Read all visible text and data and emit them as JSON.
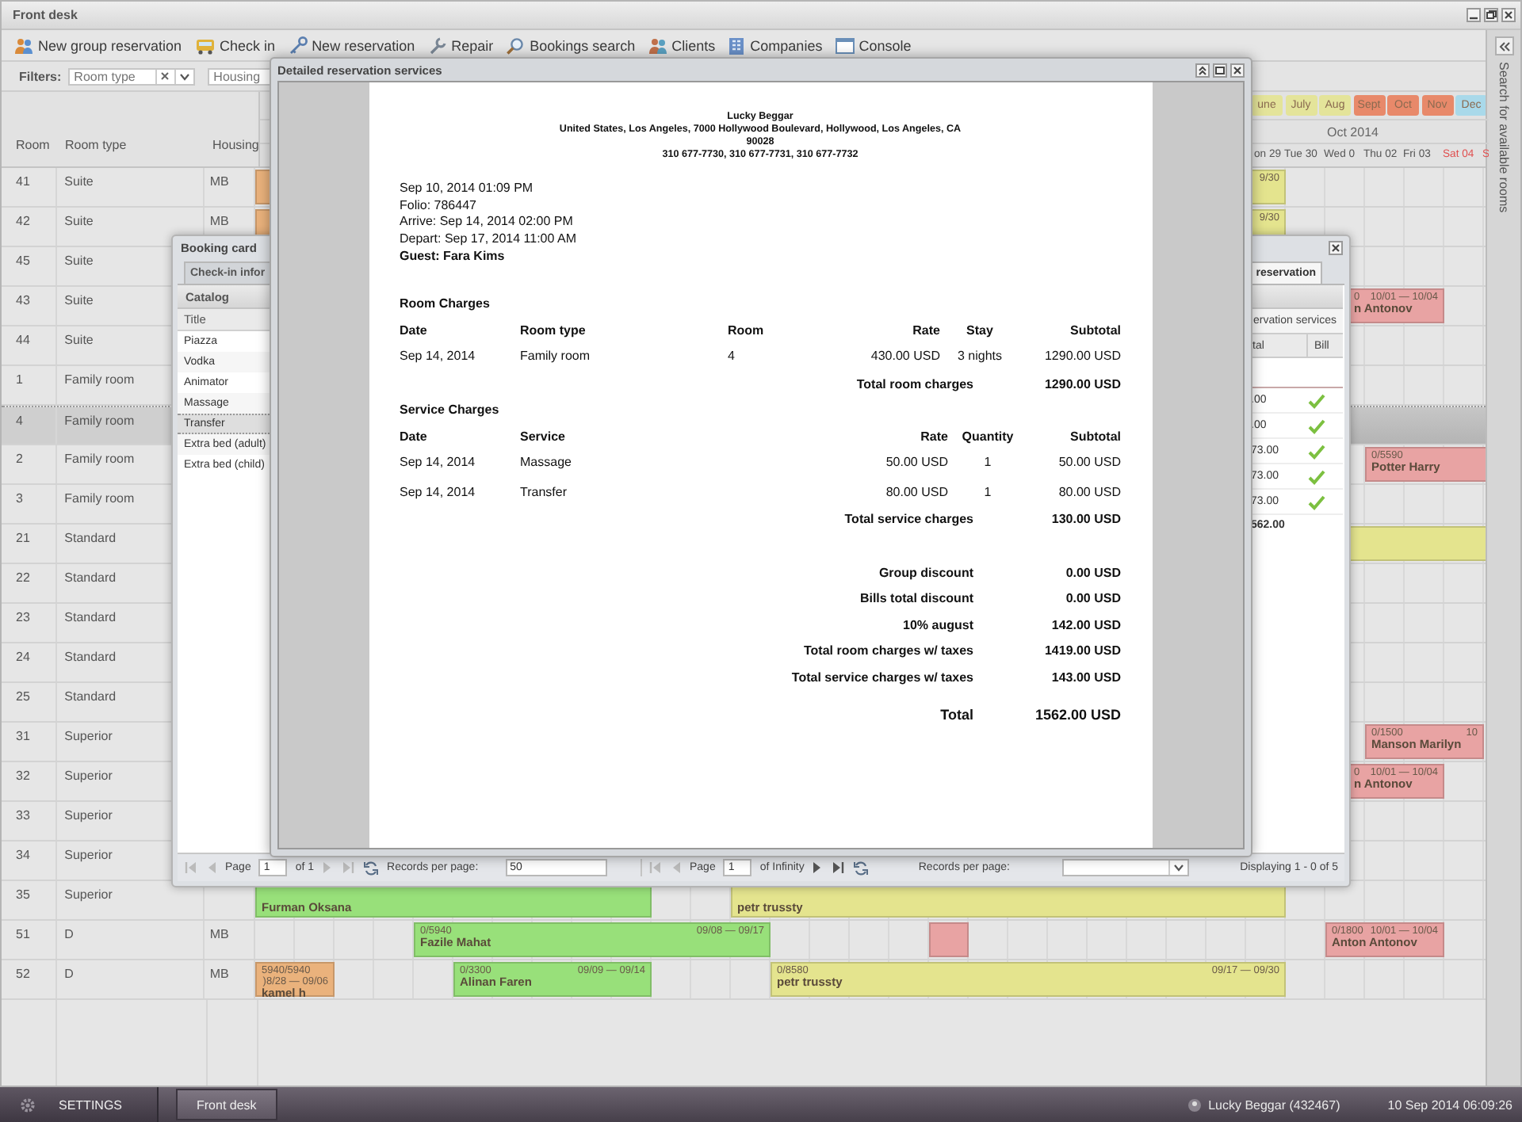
{
  "window": {
    "title": "Front desk"
  },
  "toolbar": [
    {
      "label": "New group reservation"
    },
    {
      "label": "Check in"
    },
    {
      "label": "New reservation"
    },
    {
      "label": "Repair"
    },
    {
      "label": "Bookings search"
    },
    {
      "label": "Clients"
    },
    {
      "label": "Companies"
    },
    {
      "label": "Console"
    }
  ],
  "filters": {
    "label": "Filters:",
    "room_type": {
      "placeholder": "Room type"
    },
    "housing": {
      "placeholder": "Housing"
    }
  },
  "months": [
    {
      "label": "une",
      "color": "#e4e49a"
    },
    {
      "label": "July",
      "color": "#e4e49a"
    },
    {
      "label": "Aug",
      "color": "#e4e49a"
    },
    {
      "label": "Sept",
      "color": "#e8896a"
    },
    {
      "label": "Oct",
      "color": "#e8896a"
    },
    {
      "label": "Nov",
      "color": "#e8896a"
    },
    {
      "label": "Dec",
      "color": "#a9d9ea"
    }
  ],
  "month_title": "Oct 2014",
  "days": [
    {
      "label": "on 29",
      "weekend": false
    },
    {
      "label": "Tue 30",
      "weekend": false
    },
    {
      "label": "Wed 0",
      "weekend": false
    },
    {
      "label": "Thu 02",
      "weekend": false
    },
    {
      "label": "Fri 03",
      "weekend": false
    },
    {
      "label": "Sat 04",
      "weekend": true
    },
    {
      "label": "S",
      "weekend": true
    }
  ],
  "columns": [
    "Room",
    "Room type",
    "Housing"
  ],
  "rows": [
    {
      "room": "41",
      "type": "Suite",
      "housing": "MB",
      "selected": false,
      "bookings": [
        {
          "color": "#eab27c"
        },
        {
          "color": "#e4e48e",
          "dates": "9/30"
        }
      ]
    },
    {
      "room": "42",
      "type": "Suite",
      "housing": "MB",
      "selected": false,
      "bookings": [
        {
          "color": "#eab27c"
        },
        {
          "color": "#e4e48e",
          "dates": "9/30"
        }
      ]
    },
    {
      "room": "45",
      "type": "Suite",
      "selected": false,
      "bookings": []
    },
    {
      "room": "43",
      "type": "Suite",
      "selected": false,
      "bookings": [
        {
          "color": "#e8a3a3",
          "amount": "0",
          "dates": "10/01 — 10/04",
          "name": "n Antonov"
        }
      ]
    },
    {
      "room": "44",
      "type": "Suite",
      "selected": false,
      "bookings": []
    },
    {
      "room": "1",
      "type": "Family room",
      "selected": false,
      "bookings": []
    },
    {
      "room": "4",
      "type": "Family room",
      "selected": true,
      "bookings": []
    },
    {
      "room": "2",
      "type": "Family room",
      "selected": false,
      "bookings": [
        {
          "color": "#e8a3a3",
          "amount": "0/5590",
          "name": "Potter Harry"
        }
      ]
    },
    {
      "room": "3",
      "type": "Family room",
      "selected": false,
      "bookings": []
    },
    {
      "room": "21",
      "type": "Standard",
      "selected": false,
      "bookings": [
        {
          "color": "#e4e48e"
        }
      ]
    },
    {
      "room": "22",
      "type": "Standard",
      "selected": false,
      "bookings": []
    },
    {
      "room": "23",
      "type": "Standard",
      "selected": false,
      "bookings": []
    },
    {
      "room": "24",
      "type": "Standard",
      "selected": false,
      "bookings": []
    },
    {
      "room": "25",
      "type": "Standard",
      "selected": false,
      "bookings": []
    },
    {
      "room": "31",
      "type": "Superior",
      "selected": false,
      "bookings": [
        {
          "color": "#e8a3a3",
          "amount": "0/1500",
          "dates": "10",
          "name": "Manson Marilyn"
        }
      ]
    },
    {
      "room": "32",
      "type": "Superior",
      "selected": false,
      "bookings": [
        {
          "color": "#e8a3a3",
          "amount": "0",
          "dates": "10/01 — 10/04",
          "name": "n Antonov"
        }
      ]
    },
    {
      "room": "33",
      "type": "Superior",
      "selected": false,
      "bookings": []
    },
    {
      "room": "34",
      "type": "Superior",
      "selected": false,
      "bookings": []
    },
    {
      "room": "35",
      "type": "Superior",
      "selected": false,
      "bookings": [
        {
          "color": "#98e07a",
          "name": "Furman Oksana"
        },
        {
          "color": "#e4e48e",
          "name": "petr trussty"
        }
      ]
    },
    {
      "room": "51",
      "type": "D",
      "housing": "MB",
      "selected": false,
      "bookings": [
        {
          "color": "#98e07a",
          "amount": "0/5940",
          "dates": "09/08 — 09/17",
          "name": "Fazile Mahat"
        },
        {
          "color": "#e8a3a3"
        },
        {
          "color": "#e8a3a3",
          "amount": "0/1800",
          "dates": "10/01 — 10/04",
          "name": "Anton Antonov"
        }
      ]
    },
    {
      "room": "52",
      "type": "D",
      "housing": "MB",
      "selected": false,
      "bookings": [
        {
          "color": "#eab27c",
          "amount": "5940/5940",
          "dates": ")8/28 — 09/06",
          "name": "kamel h"
        },
        {
          "color": "#98e07a",
          "amount": "0/3300",
          "dates": "09/09 — 09/14",
          "name": "Alinan Faren"
        },
        {
          "color": "#e4e48e",
          "amount": "0/8580",
          "dates": "09/17 — 09/30",
          "name": "petr trussty"
        }
      ]
    }
  ],
  "search_panel": {
    "label": "Search for available rooms"
  },
  "booking_card": {
    "title": "Booking card",
    "tabs": [
      {
        "label": "Check-in infor",
        "selected": false
      },
      {
        "label": "reservation",
        "selected": true
      }
    ],
    "catalog": {
      "title": "Catalog",
      "column": "Title",
      "items": [
        {
          "label": "Piazza",
          "selected": false
        },
        {
          "label": "Vodka",
          "selected": false
        },
        {
          "label": "Animator",
          "selected": false
        },
        {
          "label": "Massage",
          "selected": false
        },
        {
          "label": "Transfer",
          "selected": true
        },
        {
          "label": "Extra bed (adult)",
          "selected": false
        },
        {
          "label": "Extra bed (child)",
          "selected": false
        }
      ]
    },
    "services": {
      "title": "ervation services",
      "columns": [
        "tal",
        "Bill"
      ],
      "rows": [
        {
          "total": ".00",
          "billed": true
        },
        {
          "total": ".00",
          "billed": true
        },
        {
          "total": "73.00",
          "billed": true
        },
        {
          "total": "73.00",
          "billed": true
        },
        {
          "total": "73.00",
          "billed": true
        }
      ],
      "sum": "562.00"
    },
    "pager": {
      "page_label": "Page",
      "page": "1",
      "of": "of 1",
      "rpp_label": "Records per page:",
      "rpp": "50"
    },
    "pager2": {
      "page_label": "Page",
      "page": "1",
      "of": "of Infinity",
      "rpp_label": "Records per page:",
      "display": "Displaying 1 - 0 of 5"
    }
  },
  "report": {
    "title": "Detailed reservation services",
    "header": [
      "Lucky Beggar",
      "United States, Los Angeles, 7000 Hollywood Boulevard, Hollywood, Los Angeles, CA",
      "90028",
      "310 677-7730, 310 677-7731, 310 677-7732"
    ],
    "info": [
      "Sep 10, 2014 01:09 PM",
      "Folio: 786447",
      "Arrive: Sep 14, 2014 02:00 PM",
      "Depart: Sep 17, 2014 11:00 AM"
    ],
    "guest": "Guest: Fara Kims",
    "room_charges": {
      "title": "Room Charges",
      "columns": [
        "Date",
        "Room type",
        "Room",
        "Rate",
        "Stay",
        "Subtotal"
      ],
      "rows": [
        [
          "Sep 14, 2014",
          "Family room",
          "4",
          "430.00 USD",
          "3 nights",
          "1290.00 USD"
        ]
      ],
      "total_label": "Total room charges",
      "total": "1290.00 USD"
    },
    "service_charges": {
      "title": "Service Charges",
      "columns": [
        "Date",
        "Service",
        "Rate",
        "Quantity",
        "Subtotal"
      ],
      "rows": [
        [
          "Sep 14, 2014",
          "Massage",
          "50.00 USD",
          "1",
          "50.00 USD"
        ],
        [
          "Sep 14, 2014",
          "Transfer",
          "80.00 USD",
          "1",
          "80.00 USD"
        ]
      ],
      "total_label": "Total service charges",
      "total": "130.00 USD"
    },
    "summary": [
      {
        "label": "Group discount",
        "value": "0.00 USD"
      },
      {
        "label": "Bills total discount",
        "value": "0.00 USD"
      },
      {
        "label": "10% august",
        "value": "142.00 USD"
      },
      {
        "label": "Total room charges w/ taxes",
        "value": "1419.00 USD"
      },
      {
        "label": "Total service charges w/ taxes",
        "value": "143.00 USD"
      }
    ],
    "total": {
      "label": "Total",
      "value": "1562.00 USD"
    }
  },
  "taskbar": {
    "settings": "SETTINGS",
    "tabs": [
      {
        "label": "Front desk",
        "selected": true
      }
    ],
    "user": "Lucky Beggar (432467)",
    "clock": "10 Sep 2014 06:09:26"
  }
}
